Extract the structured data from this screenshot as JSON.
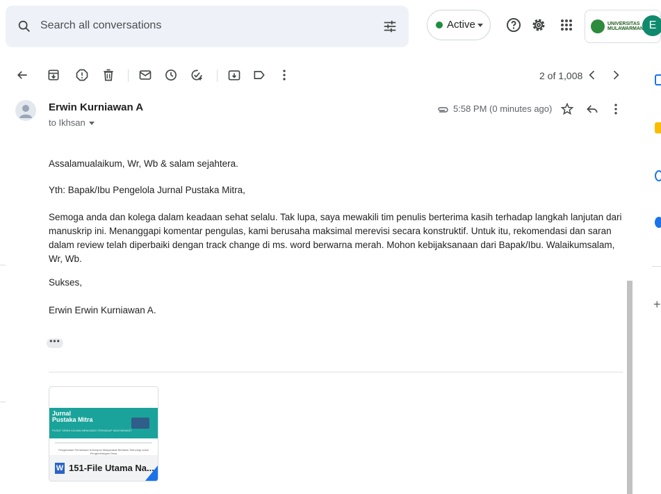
{
  "search": {
    "placeholder": "Search all conversations"
  },
  "status": {
    "label": "Active",
    "color": "#1e8e3e"
  },
  "org": {
    "name_line1": "UNIVERSITAS",
    "name_line2": "MULAWARMAN"
  },
  "account": {
    "initial": "E"
  },
  "toolbar": {
    "pager": "2 of 1,008"
  },
  "message": {
    "sender": "Erwin Kurniawan A",
    "to": "to Ikhsan",
    "time": "5:58 PM (0 minutes ago)",
    "paragraphs": {
      "p1": "Assalamualaikum, Wr, Wb & salam sejahtera.",
      "p2": "Yth: Bapak/Ibu Pengelola Jurnal Pustaka Mitra,",
      "p3": "Semoga anda dan kolega dalam keadaan sehat selalu. Tak lupa, saya mewakili tim penulis berterima kasih terhadap langkah lanjutan dari manuskrip ini. Menanggapi komentar pengulas, kami berusaha maksimal merevisi secara konstruktif. Untuk itu, rekomendasi dan saran dalam review telah diperbaiki dengan track change di ms. word berwarna merah. Mohon kebijaksanaan dari Bapak/Ibu. Walaikumsalam, Wr, Wb.",
      "p4": "Sukses,",
      "p5": "Erwin Erwin Kurniawan A."
    },
    "trimmed": "•••"
  },
  "attachment": {
    "preview_title_1": "Jurnal",
    "preview_title_2": "Pustaka Mitra",
    "preview_subtitle": "PUSAT SENIN KAJIAN MENGABDI TERHADAP MASYARAKAT",
    "preview_body": "Pengelolaan Pembinaan Kelompok Masyarakat Berbasis Teknologi untuk Pengembangan Desa",
    "type_badge": "W",
    "name": "151-File Utama Na..."
  },
  "colors": {
    "accent": "#1a73e8",
    "search_bg": "#eef2f8",
    "journal_teal": "#1aa39a"
  }
}
